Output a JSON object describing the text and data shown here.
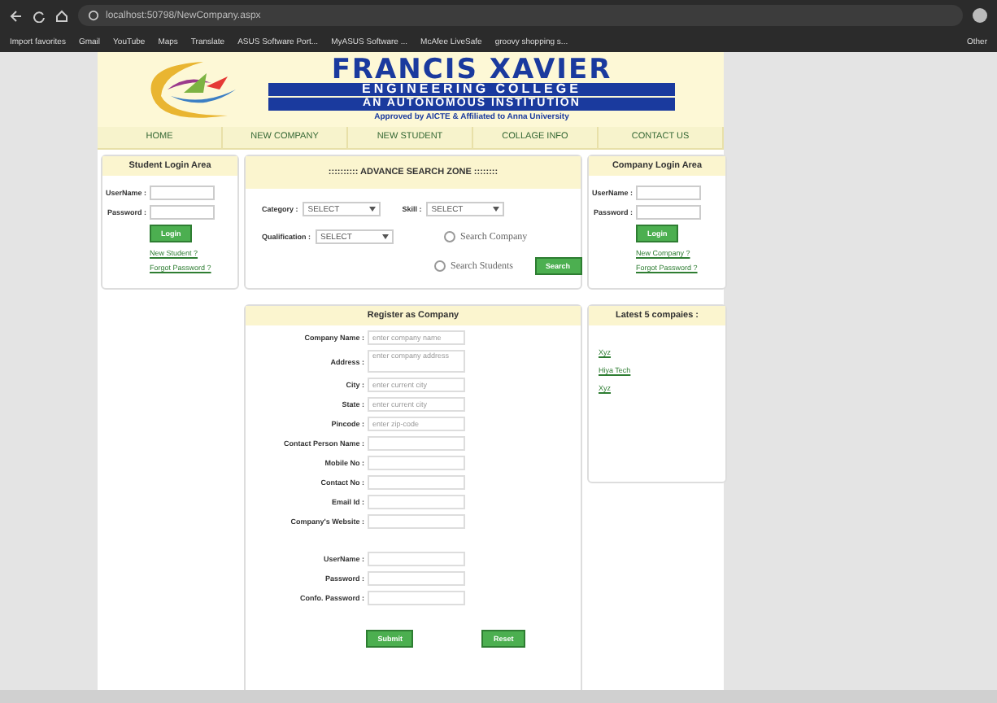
{
  "browser": {
    "url": "localhost:50798/NewCompany.aspx",
    "bookmarks": [
      "Import favorites",
      "Gmail",
      "YouTube",
      "Maps",
      "Translate",
      "ASUS Software Port...",
      "MyASUS Software ...",
      "McAfee LiveSafe",
      "groovy shopping s..."
    ],
    "other_bookmarks": "Other"
  },
  "header": {
    "title": "FRANCIS XAVIER",
    "subtitle": "ENGINEERING COLLEGE",
    "tagline": "AN AUTONOMOUS INSTITUTION",
    "approval": "Approved by AICTE & Affiliated to Anna University"
  },
  "nav": [
    "HOME",
    "NEW COMPANY",
    "NEW STUDENT",
    "COLLAGE INFO",
    "CONTACT US"
  ],
  "student_login": {
    "title": "Student Login Area",
    "fields": [
      "UserName :",
      "Password :"
    ],
    "button": "Login",
    "links": [
      "New Student ?",
      "Forgot Password ?"
    ]
  },
  "search": {
    "title": ":::::::::: ADVANCE SEARCH ZONE ::::::::",
    "category": {
      "label": "Category :",
      "value": "SELECT"
    },
    "skill": {
      "label": "Skill :",
      "value": "SELECT"
    },
    "qualification": {
      "label": "Qualification :",
      "value": "SELECT"
    },
    "radios": [
      {
        "label": "Search Company",
        "selected": false
      },
      {
        "label": "Search Students",
        "selected": false
      }
    ],
    "button": "Search"
  },
  "company_login": {
    "title": "Company Login Area",
    "fields": [
      "UserName :",
      "Password :"
    ],
    "button": "Login",
    "links": [
      "New Company ?",
      "Forgot Password ?"
    ]
  },
  "register": {
    "title": "Register as Company",
    "fields": [
      {
        "label": "Company Name :",
        "placeholder": "enter company name",
        "kind": "input"
      },
      {
        "label": "Address :",
        "placeholder": "enter company address",
        "kind": "textarea"
      },
      {
        "label": "City :",
        "placeholder": "enter current city",
        "kind": "input"
      },
      {
        "label": "State :",
        "placeholder": "enter current city",
        "kind": "input"
      },
      {
        "label": "Pincode :",
        "placeholder": "enter zip-code",
        "kind": "input"
      },
      {
        "label": "Contact Person Name :",
        "kind": "input"
      },
      {
        "label": "Mobile No :",
        "kind": "input"
      },
      {
        "label": "Contact No :",
        "kind": "input"
      },
      {
        "label": "Email Id :",
        "kind": "input"
      },
      {
        "label": "Company's Website :",
        "kind": "input"
      },
      {
        "kind": "spacer"
      },
      {
        "label": "UserName :",
        "kind": "input"
      },
      {
        "label": "Password :",
        "kind": "input"
      },
      {
        "label": "Confo. Password :",
        "kind": "input"
      }
    ],
    "buttons": [
      "Submit",
      "Reset"
    ]
  },
  "latest": {
    "title": "Latest 5 compaies :",
    "items": [
      "Xyz",
      "Hiya Tech",
      "Xyz"
    ]
  }
}
